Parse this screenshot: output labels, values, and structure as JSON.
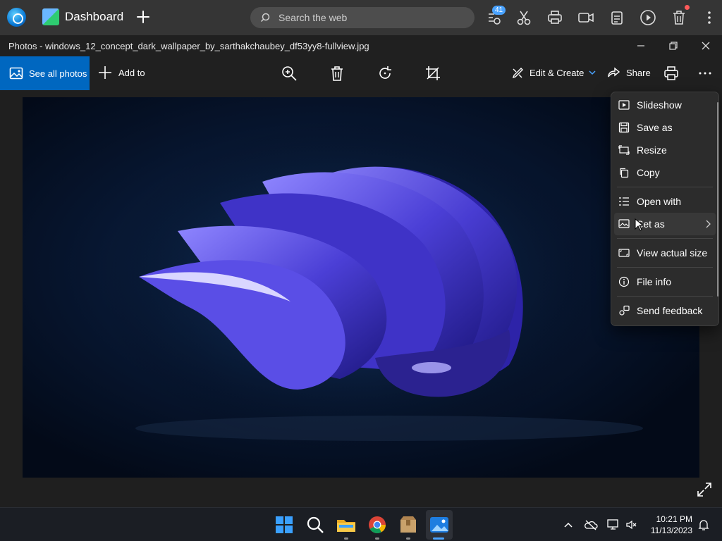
{
  "browser": {
    "tab_title": "Dashboard",
    "search_placeholder": "Search the web",
    "badge_count": "41"
  },
  "window": {
    "title": "Photos - windows_12_concept_dark_wallpaper_by_sarthakchaubey_df53yy8-fullview.jpg"
  },
  "toolbar": {
    "see_all_label": "See all photos",
    "add_to_label": "Add to",
    "edit_create_label": "Edit & Create",
    "share_label": "Share"
  },
  "menu": {
    "items": [
      {
        "label": "Slideshow",
        "icon": "slideshow-icon"
      },
      {
        "label": "Save as",
        "icon": "save-icon"
      },
      {
        "label": "Resize",
        "icon": "resize-icon"
      },
      {
        "label": "Copy",
        "icon": "copy-icon"
      },
      {
        "label": "Open with",
        "icon": "open-with-icon"
      },
      {
        "label": "Set as",
        "icon": "set-as-icon"
      },
      {
        "label": "View actual size",
        "icon": "actual-size-icon"
      },
      {
        "label": "File info",
        "icon": "info-icon"
      },
      {
        "label": "Send feedback",
        "icon": "feedback-icon"
      }
    ]
  },
  "taskbar": {
    "time": "10:21 PM",
    "date": "11/13/2023"
  },
  "colors": {
    "accent": "#0067c0",
    "photo_shape": "#4b3fd6"
  }
}
